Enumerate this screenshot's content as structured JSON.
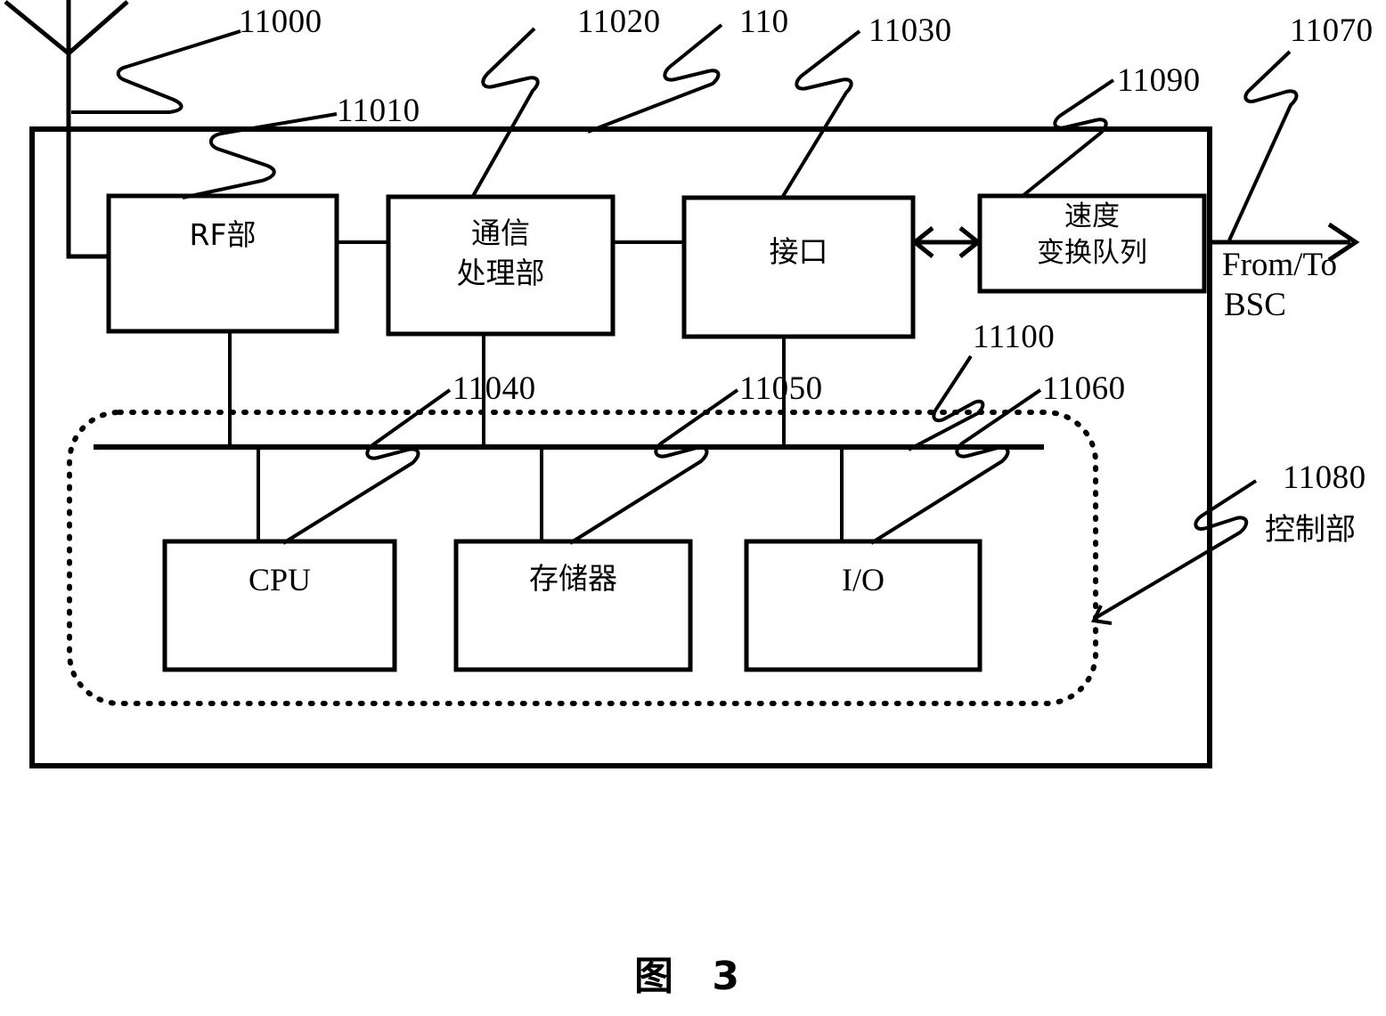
{
  "figure": {
    "caption": "图 3",
    "caption_number": "3",
    "caption_word": "图"
  },
  "colors": {
    "stroke": "#000000",
    "background": "#ffffff"
  },
  "blocks": [
    {
      "id": "rf-unit",
      "label": "RF部",
      "ref": "11010",
      "lines": [
        "RF部"
      ]
    },
    {
      "id": "comm-processor",
      "label": "通信\n处理部",
      "ref": "11020",
      "lines": [
        "通信",
        "处理部"
      ]
    },
    {
      "id": "interface",
      "label": "接口",
      "ref": "11030",
      "lines": [
        "接口"
      ]
    },
    {
      "id": "rate-queue",
      "label": "速度\n变换队列",
      "ref": "11090",
      "lines": [
        "速度",
        "变换队列"
      ]
    },
    {
      "id": "cpu",
      "label": "CPU",
      "ref": "11040",
      "lines": [
        "CPU"
      ]
    },
    {
      "id": "memory",
      "label": "存储器",
      "ref": "11050",
      "lines": [
        "存储器"
      ]
    },
    {
      "id": "io",
      "label": "I/O",
      "ref": "11060",
      "lines": [
        "I/O"
      ]
    }
  ],
  "reference_numerals": [
    {
      "id": "antenna",
      "text": "11000"
    },
    {
      "id": "rf-unit",
      "text": "11010"
    },
    {
      "id": "comm-processor",
      "text": "11020"
    },
    {
      "id": "base-station",
      "text": "110"
    },
    {
      "id": "interface",
      "text": "11030"
    },
    {
      "id": "rate-queue",
      "text": "11090"
    },
    {
      "id": "bsc-link",
      "text": "11070"
    },
    {
      "id": "cpu",
      "text": "11040"
    },
    {
      "id": "memory",
      "text": "11050"
    },
    {
      "id": "io",
      "text": "11060"
    },
    {
      "id": "bus",
      "text": "11100"
    },
    {
      "id": "control-unit",
      "text": "11080"
    }
  ],
  "annotations": {
    "bsc_link_line1": "From/To",
    "bsc_link_line2": "BSC",
    "control_unit_label": "控制部"
  }
}
